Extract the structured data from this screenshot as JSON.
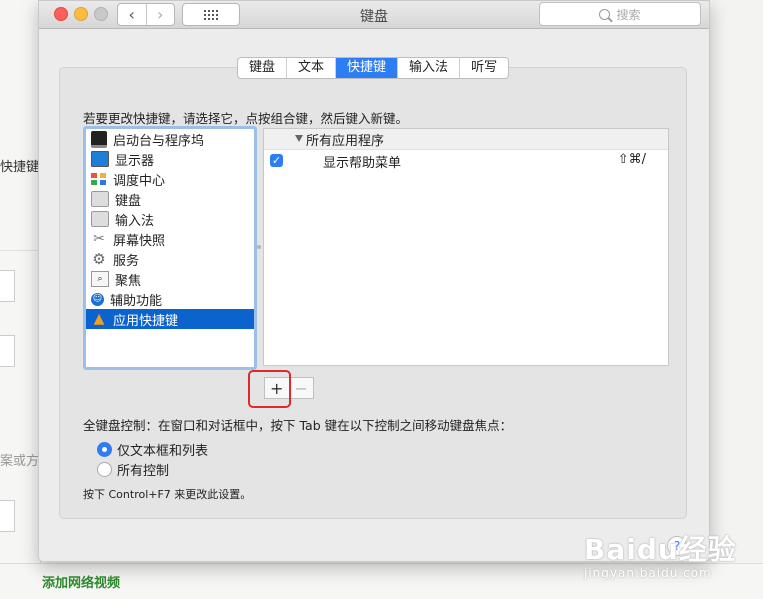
{
  "background": {
    "fragments": [
      "快捷键】",
      "案或方"
    ],
    "bottom_link": "添加网络视频"
  },
  "window": {
    "title": "键盘",
    "search_placeholder": "搜索"
  },
  "tabs": [
    {
      "label": "键盘",
      "active": false
    },
    {
      "label": "文本",
      "active": false
    },
    {
      "label": "快捷键",
      "active": true
    },
    {
      "label": "输入法",
      "active": false
    },
    {
      "label": "听写",
      "active": false
    }
  ],
  "instruction": "若要更改快捷键，请选择它，点按组合键，然后键入新键。",
  "categories": [
    {
      "label": "启动台与程序坞",
      "icon": "launchpad-dock-icon"
    },
    {
      "label": "显示器",
      "icon": "display-icon"
    },
    {
      "label": "调度中心",
      "icon": "mission-control-icon"
    },
    {
      "label": "键盘",
      "icon": "keyboard-icon"
    },
    {
      "label": "输入法",
      "icon": "input-source-icon"
    },
    {
      "label": "屏幕快照",
      "icon": "screenshot-icon"
    },
    {
      "label": "服务",
      "icon": "gear-icon"
    },
    {
      "label": "聚焦",
      "icon": "spotlight-icon"
    },
    {
      "label": "辅助功能",
      "icon": "accessibility-icon"
    },
    {
      "label": "应用快捷键",
      "icon": "app-shortcuts-icon",
      "selected": true
    }
  ],
  "shortcuts": {
    "group": "所有应用程序",
    "items": [
      {
        "label": "显示帮助菜单",
        "keys": "⇧⌘/",
        "checked": true
      }
    ]
  },
  "buttons": {
    "add": "+",
    "remove": "−"
  },
  "full_keyboard": {
    "label": "全键盘控制：在窗口和对话框中，按下 Tab 键在以下控制之间移动键盘焦点：",
    "options": [
      {
        "label": "仅文本框和列表",
        "selected": true
      },
      {
        "label": "所有控制",
        "selected": false
      }
    ],
    "note": "按下 Control+F7 来更改此设置。"
  },
  "help": "?",
  "watermark": {
    "brand": "Baidu经验",
    "site": "jingyan.baidu.com"
  },
  "colors": {
    "accent": "#2d7ef5",
    "selection": "#0b63ce",
    "highlight_box": "#e02a2a"
  }
}
